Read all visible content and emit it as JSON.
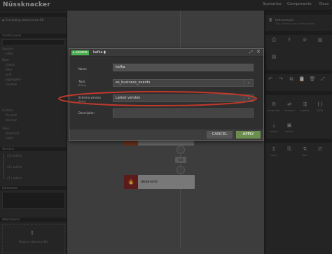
{
  "app": {
    "logo": "Nüssknacker",
    "nav": [
      "Scenarios",
      "Components",
      "Docs"
    ]
  },
  "left": {
    "status_header": "",
    "status_text": "Everything seems to be OK",
    "creator_header": "Creator panel",
    "tree": [
      "Sources",
      "kafka",
      "Base",
      "choice",
      "filter",
      "split",
      "aggregator",
      "variable",
      "Custom",
      "for-each",
      "decision",
      "Sinks",
      "dead-end",
      "kafka"
    ],
    "versions_header": "Versions",
    "versions": [
      "v3 | admin",
      "v2 | admin",
      "v1 | admin"
    ],
    "comments_header": "Comments",
    "attachments_header": "Attachments",
    "drop_text": "Drop or choose a file"
  },
  "right": {
    "scenario_label": "test-scenario",
    "scenario_sub": "This scenario has no description",
    "actions": [
      "save",
      "deploy",
      "cancel",
      "metrics"
    ],
    "edit_tools": [
      "undo",
      "redo",
      "copy",
      "paste",
      "delete",
      "layout"
    ],
    "more": [
      "properties",
      "compare",
      "migrate",
      "JSON",
      "import",
      "PDF",
      "archive",
      "count",
      "generate file",
      "test",
      "test file",
      "generate"
    ]
  },
  "canvas": {
    "pill": "0/0",
    "deadend_label": "dead-end"
  },
  "modal": {
    "tab_source": "source",
    "tab_kafka": "kafka",
    "name_label": "Name",
    "name_value": "kafka",
    "topic_label": "Topic",
    "topic_sub": "String",
    "topic_value": "es_business_events",
    "schema_label": "Schema version",
    "schema_sub": "String",
    "schema_value": "Latest version",
    "desc_label": "Description",
    "cancel": "CANCEL",
    "apply": "APPLY"
  },
  "colors": {
    "apply_bg": "#6b8e4e",
    "tab_source_bg": "#4caf50",
    "highlight_ring": "#c0392b",
    "deadend_icon_bg": "#8a2a2a"
  }
}
